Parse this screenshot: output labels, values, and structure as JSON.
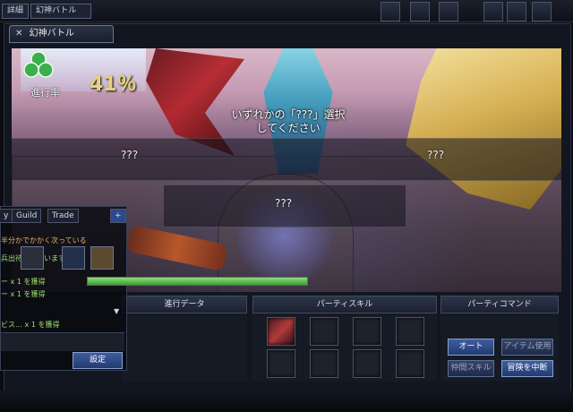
{
  "topbar": {
    "button1": "詳細",
    "button2": "幻神バトル"
  },
  "title_tab": {
    "label": "幻神バトル"
  },
  "scene": {
    "progress_label": "進行率",
    "progress_value": "41％",
    "instruction_line1": "いずれかの「???」選択",
    "instruction_line2": "してください",
    "options": [
      "???",
      "???",
      "???"
    ]
  },
  "chat": {
    "tabs": [
      "y",
      "Guild",
      "Trade",
      "+"
    ],
    "lines": [
      "半分かでかかく次っている",
      "兵出待ててています",
      "ー x 1 を獲得",
      "ー x 1 を獲得",
      "ビス… x 1 を獲得"
    ],
    "send_button": "設定"
  },
  "panels": {
    "stats_title": "進行データ",
    "party_skill_title": "パーティスキル",
    "party_command_title": "パーティコマンド",
    "commands": {
      "auto": "オート",
      "item": "アイテム使用",
      "skill": "仲間スキル",
      "retire": "冒険を中断"
    }
  },
  "colors": {
    "accent": "#e8d27a",
    "command_button": "#2f4d8c",
    "chat_text": "#9de06e"
  }
}
